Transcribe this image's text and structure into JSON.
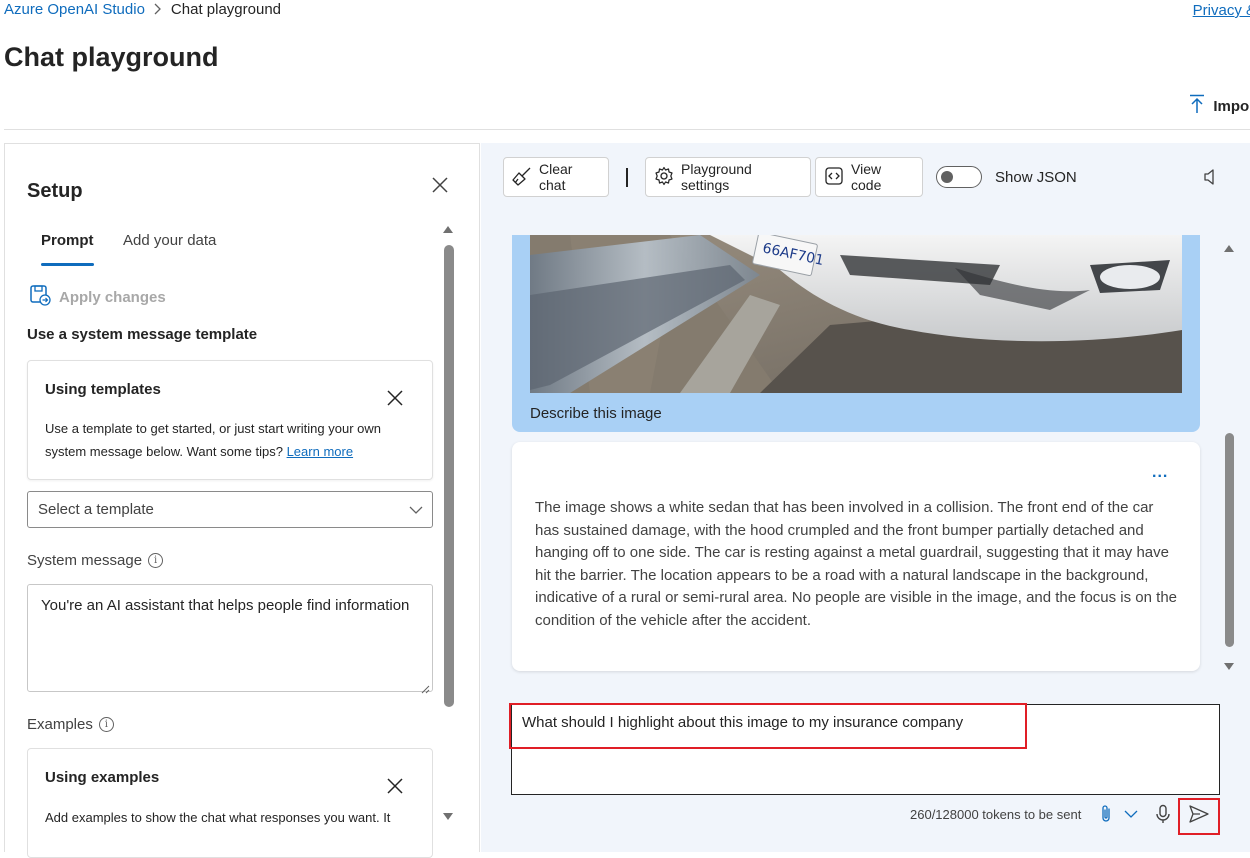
{
  "header": {
    "breadcrumb_root": "Azure OpenAI Studio",
    "breadcrumb_separator": ">",
    "breadcrumb_current": "Chat playground",
    "privacy_link": "Privacy &",
    "page_title": "Chat playground",
    "import_label": "Import"
  },
  "setup": {
    "title": "Setup",
    "tabs": [
      {
        "label": "Prompt",
        "active": true
      },
      {
        "label": "Add your data",
        "active": false
      }
    ],
    "apply_changes": "Apply changes",
    "template_heading": "Use a system message template",
    "templates_card": {
      "title": "Using templates",
      "text": "Use a template to get started, or just start writing your own system message below. Want some tips?",
      "link": "Learn more"
    },
    "template_select": "Select a template",
    "system_message_label": "System message",
    "system_message_value": "You're an AI assistant that helps people find information",
    "examples_label": "Examples",
    "examples_card": {
      "title": "Using examples",
      "text": "Add examples to show the chat what responses you want. It"
    }
  },
  "toolbar": {
    "clear_chat": "Clear chat",
    "playground_settings": "Playground settings",
    "view_code": "View code",
    "show_json": "Show JSON",
    "show_json_on": false
  },
  "chat": {
    "user_message": "Describe this image",
    "image_plate_text": "66AF701",
    "assistant_more": "...",
    "assistant_message": "The image shows a white sedan that has been involved in a collision. The front end of the car has sustained damage, with the hood crumpled and the front bumper partially detached and hanging off to one side. The car is resting against a metal guardrail, suggesting that it may have hit the barrier. The location appears to be a road with a natural landscape in the background, indicative of a rural or semi-rural area. No people are visible in the image, and the focus is on the condition of the vehicle after the accident.",
    "input_value": "What should I highlight about this image to my insurance company",
    "tokens": "260/128000 tokens to be sent"
  },
  "icons": {
    "chevron": "chevron-right-icon",
    "close": "close-icon",
    "broom": "broom-icon",
    "gear": "gear-icon",
    "code": "code-icon",
    "speaker": "speaker-icon",
    "attach": "paperclip-icon",
    "mic": "microphone-icon",
    "send": "send-icon"
  },
  "colors": {
    "accent": "#0f6cbd",
    "user_bubble": "#a9d0f5",
    "chat_background": "#f1f5fb",
    "highlight": "#e01e26"
  }
}
